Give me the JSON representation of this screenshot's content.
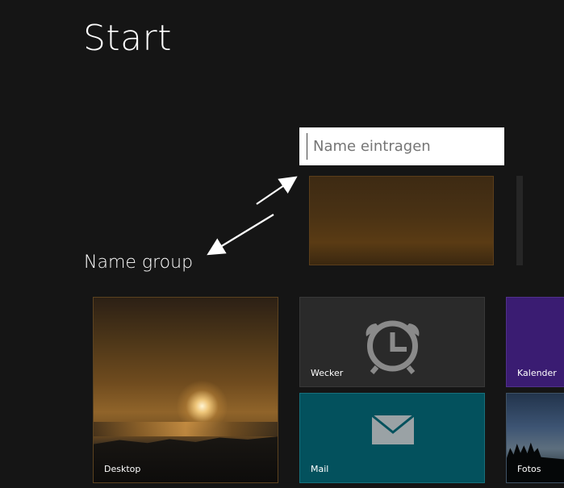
{
  "screen": {
    "title": "Start",
    "group_label": "Name group"
  },
  "name_input": {
    "placeholder": "Name eintragen",
    "value": "Name eintragen"
  },
  "tiles": {
    "desktop": {
      "label": "Desktop"
    },
    "wecker": {
      "label": "Wecker",
      "icon": "alarm-clock-icon"
    },
    "kalender": {
      "label": "Kalender"
    },
    "mail": {
      "label": "Mail",
      "icon": "mail-icon"
    },
    "fotos": {
      "label": "Fotos"
    }
  },
  "colors": {
    "background": "#151515",
    "wecker_tile": "#2a2a2a",
    "mail_tile": "#03515d",
    "kalender_tile": "#3a1c72",
    "input_background": "#ffffff",
    "text": "#ffffff"
  }
}
